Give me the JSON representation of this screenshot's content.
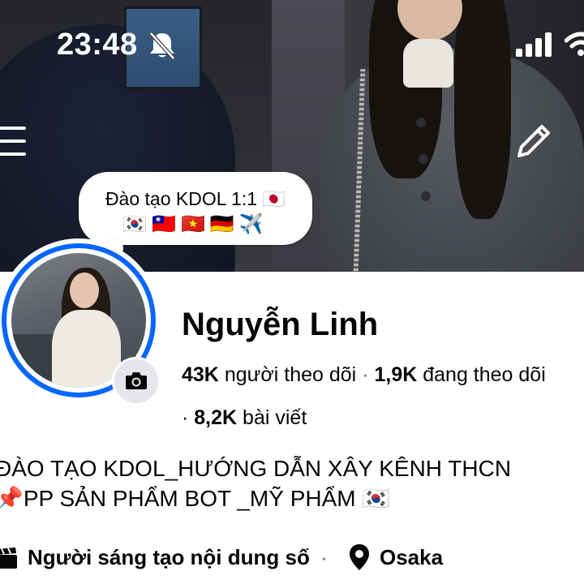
{
  "status_bar": {
    "time": "23:48"
  },
  "note": {
    "line1": "Đào tạo KDOL 1:1 🇯🇵",
    "line2": "🇰🇷🇹🇼🇻🇳🇩🇪✈️"
  },
  "profile": {
    "name": "Nguyễn Linh",
    "followers_count": "43K",
    "followers_label": "người theo dõi",
    "following_count": "1,9K",
    "following_label": "đang theo dõi",
    "posts_count": "8,2K",
    "posts_label": "bài viết"
  },
  "bio": {
    "line1": "ĐÀO TẠO KDOL_HƯỚNG DẪN XÂY KÊNH THCN",
    "line2": "📌PP SẢN PHẨM BOT _MỸ PHẨM 🇰🇷"
  },
  "info": {
    "category": "Người sáng tạo nội dung số",
    "location": "Osaka"
  },
  "colors": {
    "accent": "#0866ff",
    "text": "#050505",
    "secondary_text": "#65676b"
  },
  "icons": [
    "bell-slash-icon",
    "signal-icon",
    "wifi-icon",
    "menu-icon",
    "pencil-icon",
    "camera-icon",
    "clapperboard-icon",
    "location-pin-icon"
  ]
}
